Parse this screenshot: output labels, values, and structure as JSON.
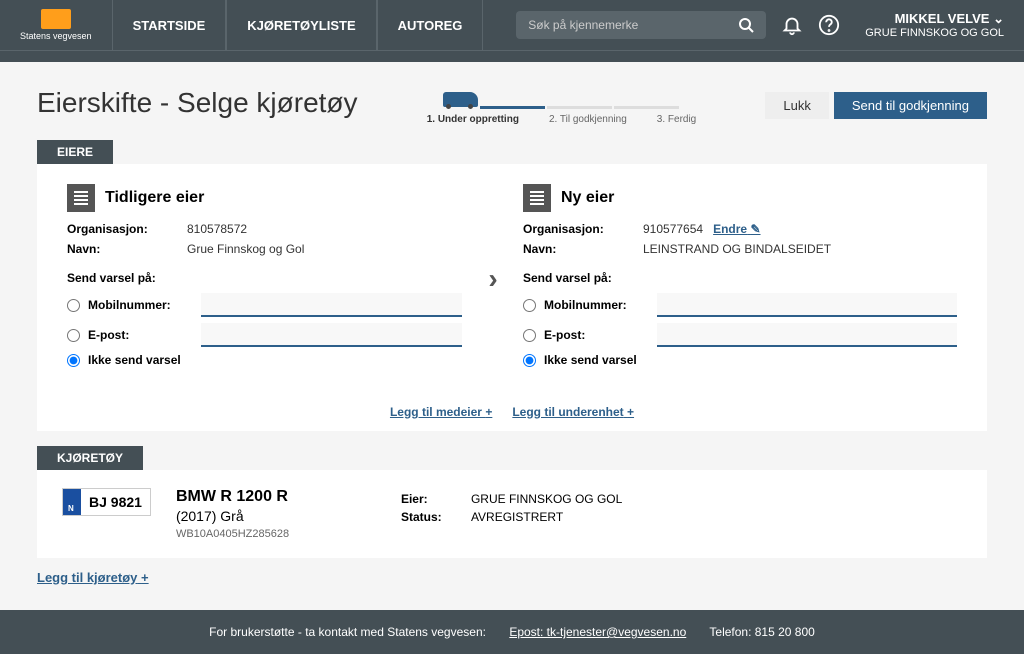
{
  "header": {
    "logo_text": "Statens vegvesen",
    "nav": [
      "STARTSIDE",
      "KJØRETØYLISTE",
      "AUTOREG"
    ],
    "search_placeholder": "Søk på kjennemerke",
    "user_name": "MIKKEL VELVE",
    "user_org": "GRUE FINNSKOG OG GOL"
  },
  "page": {
    "title": "Eierskifte - Selge kjøretøy",
    "steps": [
      "1. Under oppretting",
      "2. Til godkjenning",
      "3. Ferdig"
    ],
    "btn_close": "Lukk",
    "btn_send": "Send til godkjenning"
  },
  "sections": {
    "owners": "EIERE",
    "vehicle": "KJØRETØY"
  },
  "prev_owner": {
    "title": "Tidligere eier",
    "org_label": "Organisasjon:",
    "org_value": "810578572",
    "name_label": "Navn:",
    "name_value": "Grue Finnskog og Gol",
    "send_label": "Send varsel på:",
    "mobile_label": "Mobilnummer:",
    "email_label": "E-post:",
    "none_label": "Ikke send varsel"
  },
  "new_owner": {
    "title": "Ny eier",
    "org_label": "Organisasjon:",
    "org_value": "910577654",
    "change_link": "Endre",
    "name_label": "Navn:",
    "name_value": "LEINSTRAND OG BINDALSEIDET",
    "send_label": "Send varsel på:",
    "mobile_label": "Mobilnummer:",
    "email_label": "E-post:",
    "none_label": "Ikke send varsel"
  },
  "add_links": {
    "coowner": "Legg til medeier",
    "subunit": "Legg til underenhet"
  },
  "vehicle": {
    "plate": "BJ 9821",
    "model": "BMW R 1200 R",
    "year_color": "(2017) Grå",
    "vin": "WB10A0405HZ285628",
    "owner_label": "Eier:",
    "owner_value": "GRUE FINNSKOG OG GOL",
    "status_label": "Status:",
    "status_value": "AVREGISTRERT",
    "add_link": "Legg til kjøretøy"
  },
  "footer": {
    "text": "For brukerstøtte - ta kontakt med Statens vegvesen:",
    "email_label": "Epost: tk-tjenester@vegvesen.no",
    "phone": "Telefon: 815 20 800"
  }
}
